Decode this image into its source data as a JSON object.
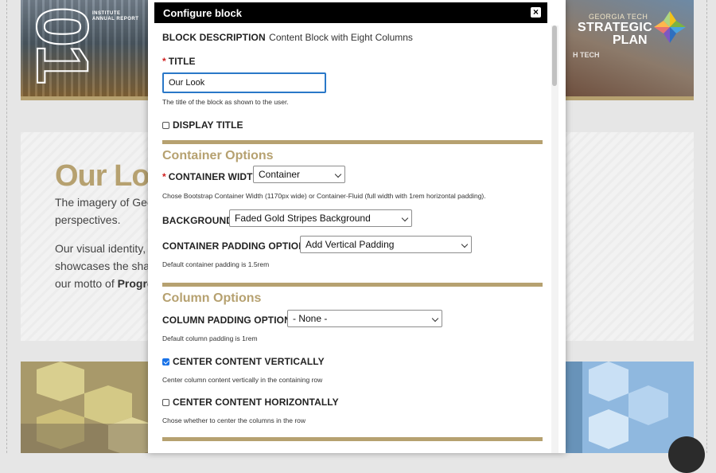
{
  "background": {
    "banner_left_number": "01",
    "banner_left_small": "INSTITUTE ANNUAL REPORT",
    "banner_right_org": "GEORGIA TECH",
    "banner_right_line1": "STRATEGIC",
    "banner_right_line2": "PLAN",
    "banner_right_caption": "H TECH",
    "section_title": "Our Loo",
    "para1_line1": "The imagery of Geo",
    "para1_line2": "perspectives.",
    "para2_line1": "Our visual identity, r",
    "para2_line2": "showcases the sha",
    "para2_line3_prefix": "our motto of ",
    "para2_line3_bold": "Progre"
  },
  "modal": {
    "title": "Configure block",
    "close_icon": "close-icon",
    "block_description_label": "BLOCK DESCRIPTION",
    "block_description_value": "Content Block with Eight Columns",
    "title_label": "TITLE",
    "title_value": "Our Look",
    "title_help": "The title of the block as shown to the user.",
    "display_title_label": "DISPLAY TITLE",
    "display_title_checked": false,
    "container_options_heading": "Container Options",
    "container_width_label": "CONTAINER WIDTH",
    "container_width_value": "Container",
    "container_width_help": "Chose Bootstrap Container Width (1170px wide) or Container-Fluid (full width with 1rem horizontal padding).",
    "background_label": "BACKGROUND",
    "background_value": "Faded Gold Stripes Background",
    "container_padding_label": "CONTAINER PADDING OPTIONS",
    "container_padding_value": "Add Vertical Padding",
    "container_padding_help": "Default container padding is 1.5rem",
    "column_options_heading": "Column Options",
    "column_padding_label": "COLUMN PADDING OPTIONS",
    "column_padding_value": "- None -",
    "column_padding_help": "Default column padding is 1rem",
    "center_vertical_label": "CENTER CONTENT VERTICALLY",
    "center_vertical_checked": true,
    "center_vertical_help": "Center column content vertically in the containing row",
    "center_horizontal_label": "CENTER CONTENT HORIZONTALLY",
    "center_horizontal_checked": false,
    "center_horizontal_help": "Chose whether to center the columns in the row",
    "required_marker": "*"
  },
  "colors": {
    "accent_gold": "#b6a170",
    "focus_blue": "#2a78c8",
    "header_black": "#000000",
    "required_red": "#d02020"
  }
}
